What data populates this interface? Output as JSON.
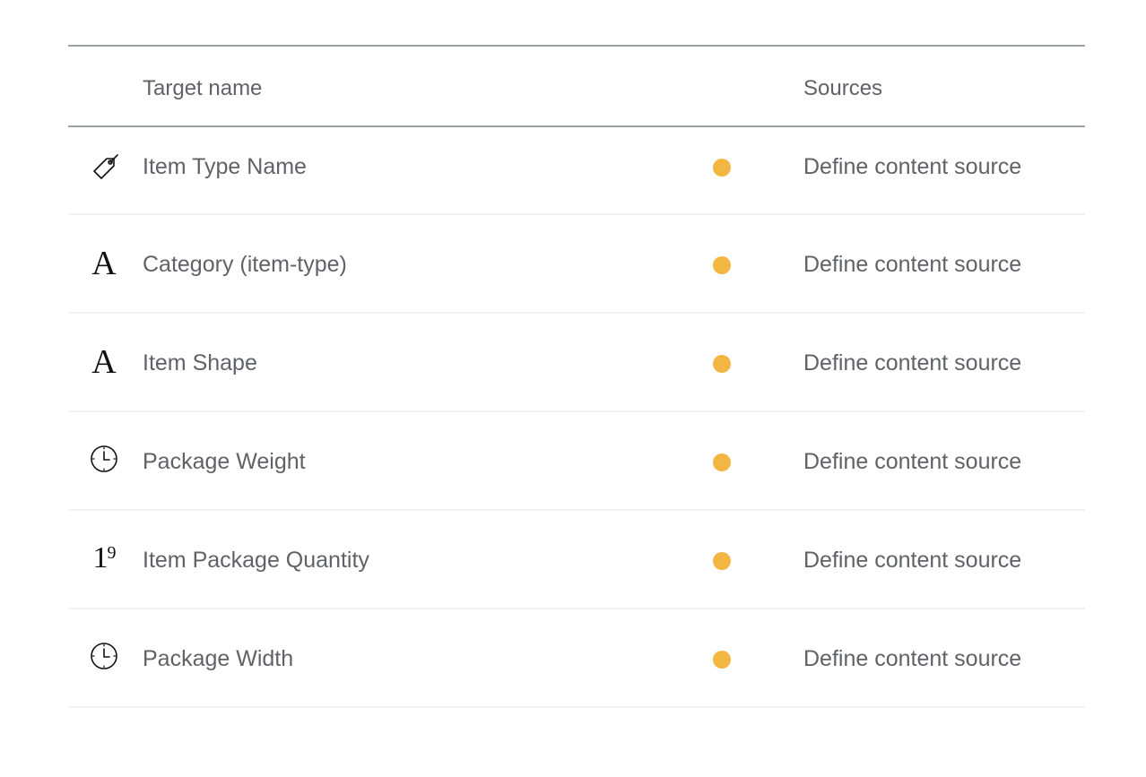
{
  "header": {
    "target_name": "Target name",
    "sources": "Sources"
  },
  "colors": {
    "status_dot": "#f4b642",
    "header_rule": "#9aa1a8",
    "row_rule": "#f0f1f2",
    "text": "#5f6368"
  },
  "rows": [
    {
      "icon": "tag-icon",
      "label": "Item Type Name",
      "source": "Define content source"
    },
    {
      "icon": "text-type-icon",
      "glyph": "A",
      "label": "Category (item-type)",
      "source": "Define content source"
    },
    {
      "icon": "text-type-icon",
      "glyph": "A",
      "label": "Item Shape",
      "source": "Define content source"
    },
    {
      "icon": "clock-icon",
      "label": "Package Weight",
      "source": "Define content source"
    },
    {
      "icon": "number-type-icon",
      "glyph_main": "1",
      "glyph_sup": "9",
      "label": "Item Package Quantity",
      "source": "Define content source"
    },
    {
      "icon": "clock-icon",
      "label": "Package Width",
      "source": "Define content source"
    }
  ]
}
